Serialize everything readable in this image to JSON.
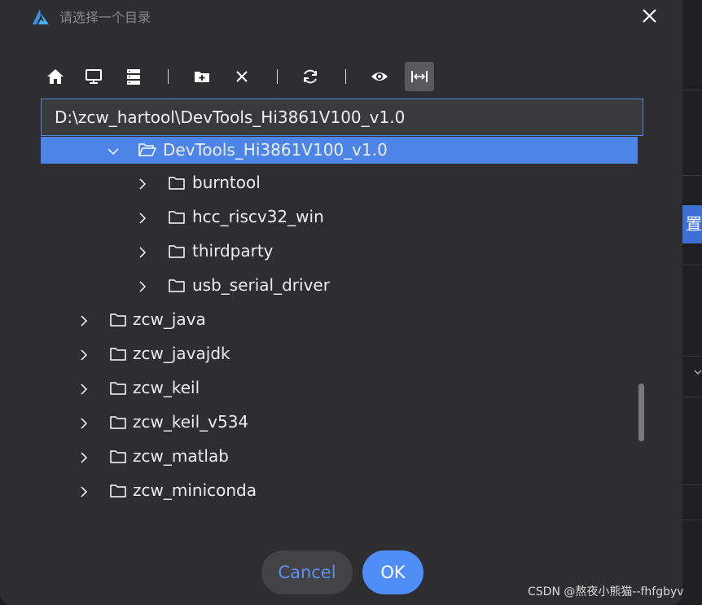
{
  "dialog": {
    "title": "请选择一个目录",
    "close_icon": "close-icon"
  },
  "toolbar": {
    "buttons": [
      {
        "icon": "home-icon",
        "name": "home"
      },
      {
        "icon": "desktop-icon",
        "name": "desktop"
      },
      {
        "icon": "drives-icon",
        "name": "drives"
      },
      {
        "icon": "new-folder-icon",
        "name": "new-folder"
      },
      {
        "icon": "delete-icon",
        "name": "delete"
      },
      {
        "icon": "refresh-icon",
        "name": "refresh"
      },
      {
        "icon": "eye-icon",
        "name": "show-hidden"
      },
      {
        "icon": "fit-width-icon",
        "name": "fit-width",
        "active": true
      }
    ]
  },
  "path": {
    "value": "D:\\zcw_hartool\\DevTools_Hi3861V100_v1.0"
  },
  "tree": {
    "items": [
      {
        "label": "DevTools_Hi3861V100_v1.0",
        "expanded": true,
        "selected": true
      },
      {
        "label": "burntool"
      },
      {
        "label": "hcc_riscv32_win"
      },
      {
        "label": "thirdparty"
      },
      {
        "label": "usb_serial_driver"
      },
      {
        "label": "zcw_java"
      },
      {
        "label": "zcw_javajdk"
      },
      {
        "label": "zcw_keil"
      },
      {
        "label": "zcw_keil_v534"
      },
      {
        "label": "zcw_matlab"
      },
      {
        "label": "zcw_miniconda"
      }
    ]
  },
  "footer": {
    "cancel_label": "Cancel",
    "ok_label": "OK"
  },
  "background": {
    "button_text": "置"
  },
  "watermark": "CSDN @熬夜小熊猫--fhfgbyv",
  "colors": {
    "accent": "#4f8ef7",
    "selection": "#4d85e6",
    "dialog_bg": "#2e2e30"
  }
}
